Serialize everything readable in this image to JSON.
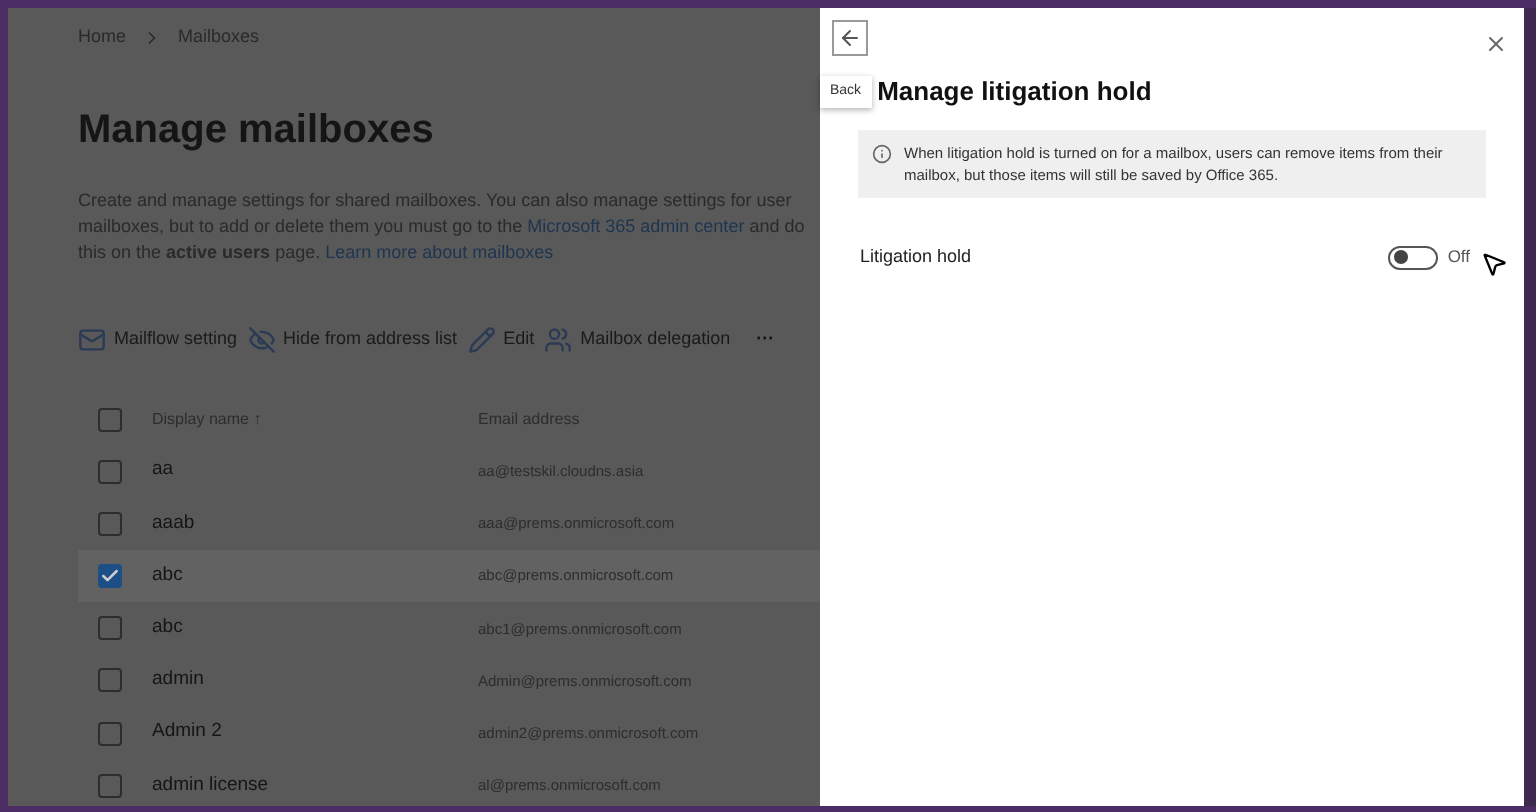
{
  "breadcrumb": [
    "Home",
    "Mailboxes"
  ],
  "page_title": "Manage mailboxes",
  "description": {
    "text": "Create and manage settings for shared mailboxes. You can also manage settings for user mailboxes, but to add or delete them you must go to the ",
    "link": "Microsoft 365 admin center",
    "text_after": " and do this on the ",
    "bold": "active users",
    "text_end": " page. ",
    "learn_more": "Learn more about mailboxes"
  },
  "toolbar": [
    {
      "label": "Mailflow setting",
      "kind": "mailflow"
    },
    {
      "label": "Hide from address list",
      "kind": "hide"
    },
    {
      "label": "Edit",
      "kind": "edit"
    },
    {
      "label": "Mailbox delegation",
      "kind": "delegation"
    },
    {
      "label": "···",
      "kind": "more"
    }
  ],
  "table": {
    "columns": [
      "Display name ↑",
      "Email address"
    ],
    "header_checked": false,
    "rows": [
      {
        "name": "aa",
        "email": "aa@testskil.cloudns.asia",
        "selected": false
      },
      {
        "name": "aaab",
        "email": "aaa@prems.onmicrosoft.com",
        "selected": false
      },
      {
        "name": "abc",
        "email": "abc@prems.onmicrosoft.com",
        "selected": true
      },
      {
        "name": "abc",
        "email": "abc1@prems.onmicrosoft.com",
        "selected": false
      },
      {
        "name": "admin",
        "email": "Admin@prems.onmicrosoft.com",
        "selected": false
      },
      {
        "name": "Admin 2",
        "email": "admin2@prems.onmicrosoft.com",
        "selected": false
      },
      {
        "name": "admin license",
        "email": "al@prems.onmicrosoft.com",
        "selected": false
      }
    ]
  },
  "panel": {
    "back_tooltip": "Back",
    "title": "Manage litigation hold",
    "info": "When litigation hold is turned on for a mailbox, users can remove items from their mailbox, but those items will still be saved by Office 365.",
    "setting": {
      "label": "Litigation hold",
      "on": false,
      "state_text": "Off"
    }
  }
}
